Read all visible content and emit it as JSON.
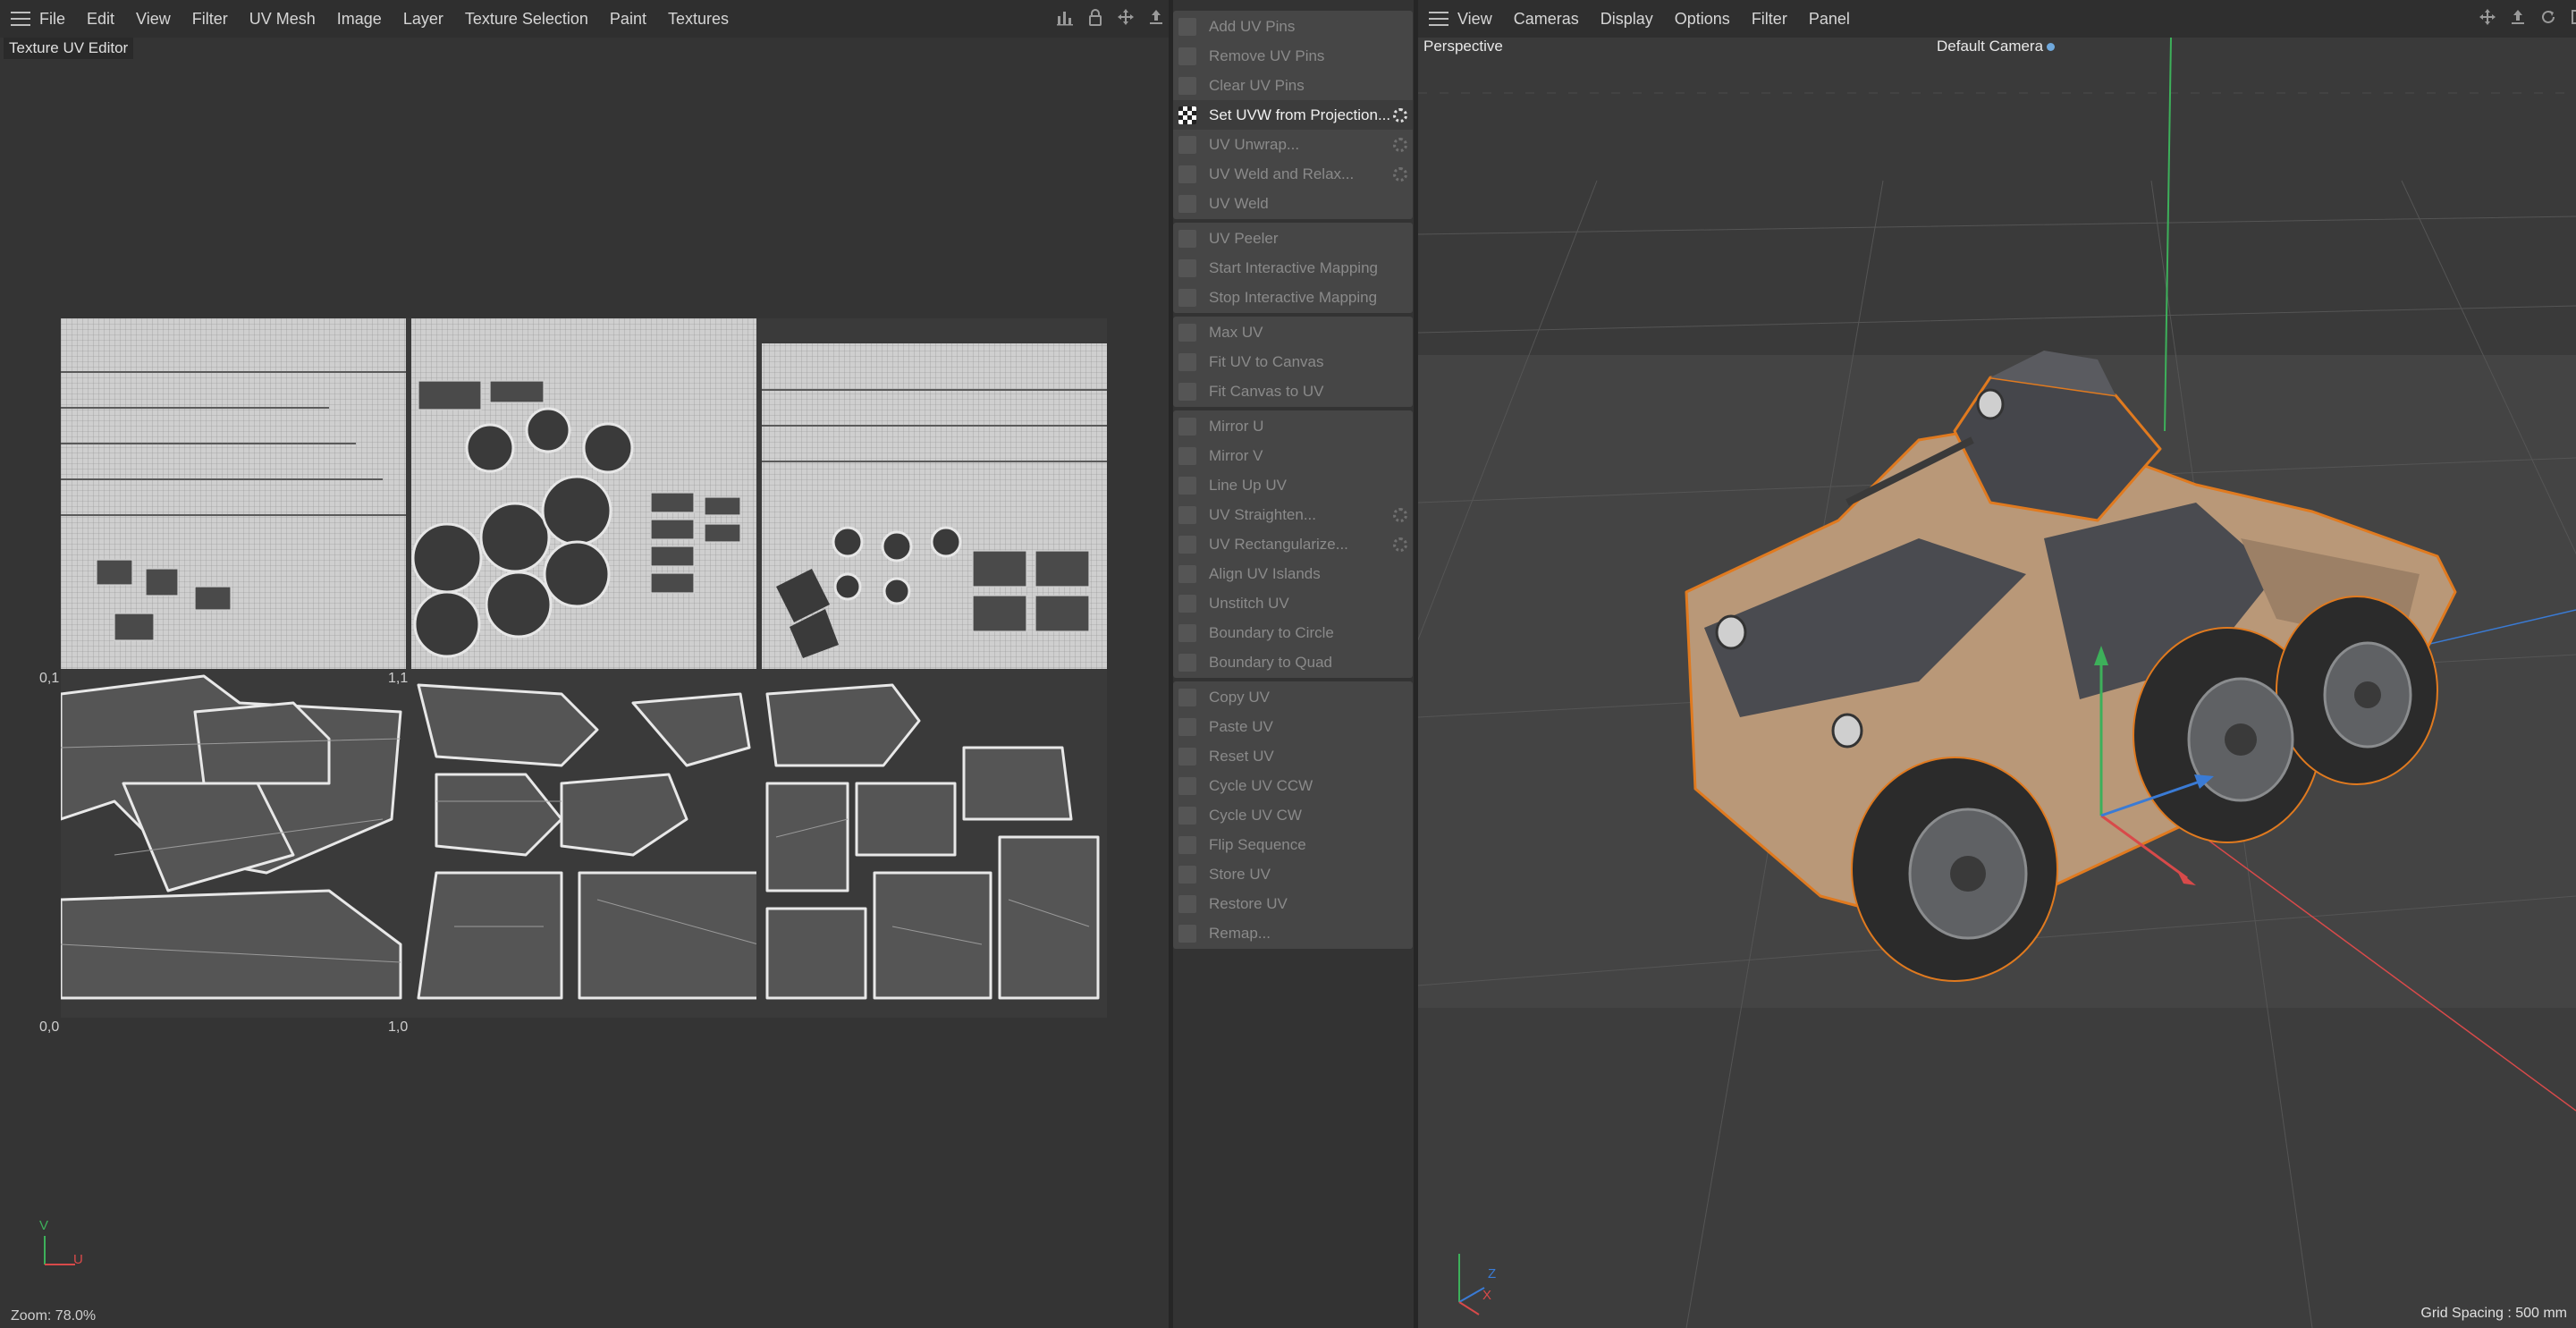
{
  "uv_editor": {
    "menu": [
      "File",
      "Edit",
      "View",
      "Filter",
      "UV Mesh",
      "Image",
      "Layer",
      "Texture Selection",
      "Paint",
      "Textures"
    ],
    "title": "Texture UV Editor",
    "header_icons": [
      "histogram-icon",
      "lock-icon",
      "move-icon",
      "upload-icon"
    ],
    "uv_labels": {
      "top_left": "0,1",
      "top_right": "1,1",
      "bottom_left": "0,0",
      "bottom_right": "1,0"
    },
    "axes": {
      "v": "V",
      "u": "U"
    },
    "zoom": "Zoom: 78.0%"
  },
  "uv_commands": {
    "groups": [
      [
        {
          "label": "Add UV Pins",
          "icon": "pin-add-icon",
          "enabled": false
        },
        {
          "label": "Remove UV Pins",
          "icon": "pin-remove-icon",
          "enabled": false
        },
        {
          "label": "Clear UV Pins",
          "icon": "pin-clear-icon",
          "enabled": false
        },
        {
          "label": "Set UVW from Projection...",
          "icon": "checker-icon",
          "enabled": true,
          "gear": true
        },
        {
          "label": "UV Unwrap...",
          "icon": "unwrap-icon",
          "enabled": false,
          "gear": true
        },
        {
          "label": "UV Weld and Relax...",
          "icon": "weld-relax-icon",
          "enabled": false,
          "gear": true
        },
        {
          "label": "UV Weld",
          "icon": "weld-icon",
          "enabled": false
        }
      ],
      [
        {
          "label": "UV Peeler",
          "icon": "peeler-icon",
          "enabled": false
        },
        {
          "label": "Start Interactive Mapping",
          "icon": "start-mapping-icon",
          "enabled": false
        },
        {
          "label": "Stop Interactive Mapping",
          "icon": "stop-mapping-icon",
          "enabled": false
        }
      ],
      [
        {
          "label": "Max UV",
          "icon": "max-uv-icon",
          "enabled": false
        },
        {
          "label": "Fit UV to Canvas",
          "icon": "fit-uv-icon",
          "enabled": false
        },
        {
          "label": "Fit Canvas to UV",
          "icon": "fit-canvas-icon",
          "enabled": false
        }
      ],
      [
        {
          "label": "Mirror U",
          "icon": "mirror-u-icon",
          "enabled": false
        },
        {
          "label": "Mirror V",
          "icon": "mirror-v-icon",
          "enabled": false
        },
        {
          "label": "Line Up UV",
          "icon": "line-up-icon",
          "enabled": false
        },
        {
          "label": "UV Straighten...",
          "icon": "straighten-icon",
          "enabled": false,
          "gear": true
        },
        {
          "label": "UV Rectangularize...",
          "icon": "rectangularize-icon",
          "enabled": false,
          "gear": true
        },
        {
          "label": "Align UV Islands",
          "icon": "align-islands-icon",
          "enabled": false
        },
        {
          "label": "Unstitch UV",
          "icon": "unstitch-icon",
          "enabled": false
        },
        {
          "label": "Boundary to Circle",
          "icon": "boundary-circle-icon",
          "enabled": false
        },
        {
          "label": "Boundary to Quad",
          "icon": "boundary-quad-icon",
          "enabled": false
        }
      ],
      [
        {
          "label": "Copy UV",
          "icon": "copy-icon",
          "enabled": false
        },
        {
          "label": "Paste UV",
          "icon": "paste-icon",
          "enabled": false
        },
        {
          "label": "Reset UV",
          "icon": "reset-icon",
          "enabled": false
        },
        {
          "label": "Cycle UV CCW",
          "icon": "cycle-ccw-icon",
          "enabled": false
        },
        {
          "label": "Cycle UV CW",
          "icon": "cycle-cw-icon",
          "enabled": false
        },
        {
          "label": "Flip Sequence",
          "icon": "flip-icon",
          "enabled": false
        },
        {
          "label": "Store UV",
          "icon": "store-icon",
          "enabled": false
        },
        {
          "label": "Restore UV",
          "icon": "restore-icon",
          "enabled": false
        },
        {
          "label": "Remap...",
          "icon": "remap-icon",
          "enabled": false
        }
      ]
    ]
  },
  "viewport": {
    "menu": [
      "View",
      "Cameras",
      "Display",
      "Options",
      "Filter",
      "Panel"
    ],
    "projection": "Perspective",
    "camera": "Default Camera",
    "grid_spacing": "Grid Spacing : 500 mm",
    "axes": {
      "z": "Z",
      "x": "X"
    },
    "header_icons": [
      "move-icon",
      "upload-icon",
      "rotate-icon",
      "maximize-icon"
    ]
  },
  "colors": {
    "selection_outline": "#e07a1f",
    "axis_x": "#d84a4a",
    "axis_y": "#3db05a",
    "axis_z": "#3a7bd5",
    "uv_lines": "#d9d9d9"
  }
}
